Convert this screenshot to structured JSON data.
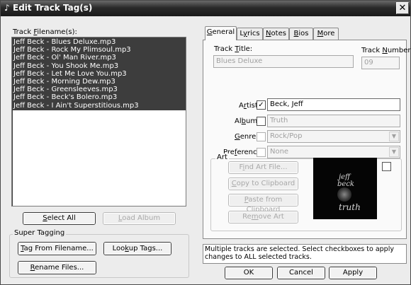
{
  "window": {
    "title": "Edit Track Tag(s)",
    "close_glyph": "✕",
    "icon_glyph": "♪"
  },
  "left": {
    "list_label_pre": "Track ",
    "list_label_u": "F",
    "list_label_post": "ilename(s):",
    "tracks": [
      "Jeff Beck - Blues Deluxe.mp3",
      "Jeff Beck - Rock My Plimsoul.mp3",
      "Jeff Beck - Ol' Man River.mp3",
      "Jeff Beck - You Shook Me.mp3",
      "Jeff Beck - Let Me Love You.mp3",
      "Jeff Beck - Morning Dew.mp3",
      "Jeff Beck - Greensleeves.mp3",
      "Jeff Beck - Beck's Bolero.mp3",
      "Jeff Beck - I Ain't Superstitious.mp3"
    ],
    "select_all": {
      "u": "S",
      "rest": "elect All"
    },
    "load_album": {
      "u": "L",
      "rest": "oad Album"
    },
    "super_tagging_label": "Super Tagging",
    "tag_from_filename": {
      "u": "T",
      "rest": "ag From Filename..."
    },
    "lookup_tags": {
      "pre": "Loo",
      "u": "k",
      "rest": "up Tags..."
    },
    "rename_files": {
      "u": "R",
      "rest": "ename Files..."
    }
  },
  "tabs": [
    {
      "pre": "",
      "u": "G",
      "rest": "eneral",
      "active": true
    },
    {
      "pre": "L",
      "u": "y",
      "rest": "rics",
      "active": false
    },
    {
      "pre": "",
      "u": "N",
      "rest": "otes",
      "active": false
    },
    {
      "pre": "",
      "u": "B",
      "rest": "ios",
      "active": false
    },
    {
      "pre": "",
      "u": "M",
      "rest": "ore",
      "active": false
    }
  ],
  "general": {
    "track_title_label": {
      "pre": "Track ",
      "u": "T",
      "rest": "itle:"
    },
    "track_title_value": "Blues Deluxe",
    "track_number_label": {
      "pre": "Track ",
      "u": "N",
      "rest": "umber:"
    },
    "track_number_value": "09",
    "artist_label": {
      "pre": "A",
      "u": "r",
      "rest": "tist:"
    },
    "artist_checked": true,
    "artist_value": "Beck, Jeff",
    "album_label": {
      "pre": "Al",
      "u": "b",
      "rest": "um:"
    },
    "album_value": "Truth",
    "genre_label": {
      "pre": "",
      "u": "G",
      "rest": "enre:"
    },
    "genre_value": "Rock/Pop",
    "preference_label": {
      "pre": "Pre",
      "u": "f",
      "rest": "erence:"
    },
    "preference_value": "None",
    "art_group_label": "Art",
    "find_art": {
      "pre": "F",
      "u": "i",
      "rest": "nd Art File..."
    },
    "copy_clipboard": {
      "pre": "",
      "u": "C",
      "rest": "opy to Clipboard"
    },
    "paste_clipboard": {
      "pre": "",
      "u": "P",
      "rest": "aste from Clipboard"
    },
    "remove_art": {
      "pre": "Re",
      "u": "m",
      "rest": "ove Art"
    },
    "cover_line1": "jeff",
    "cover_line2": "beck",
    "cover_line3": "truth",
    "combo_arrow": "▼",
    "check_glyph": "✓"
  },
  "status": {
    "message": "Multiple tracks are selected. Select checkboxes to apply changes to ALL selected tracks."
  },
  "footer": {
    "ok": "OK",
    "cancel": "Cancel",
    "apply": "Apply"
  }
}
